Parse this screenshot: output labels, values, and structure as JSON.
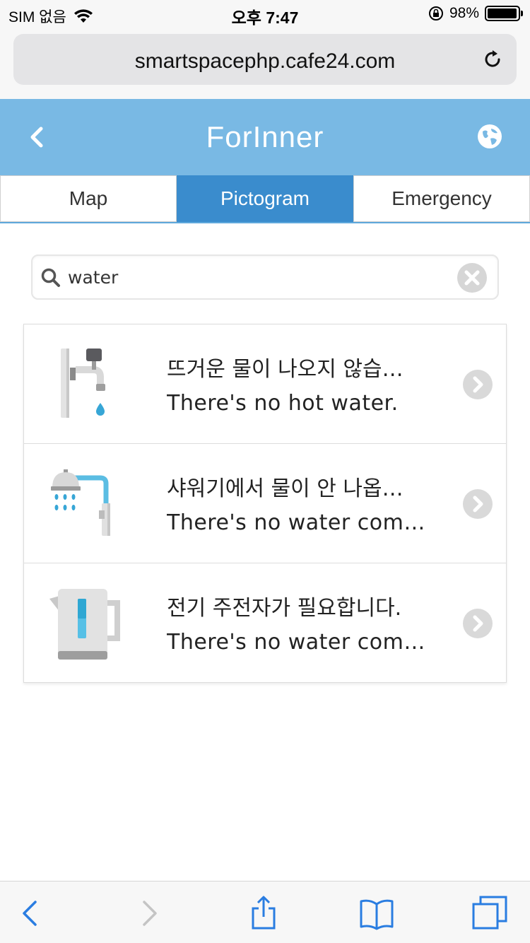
{
  "status": {
    "carrier": "SIM 없음",
    "time": "오후 7:47",
    "battery": "98%",
    "battery_level": 0.98
  },
  "browser": {
    "url": "smartspacephp.cafe24.com"
  },
  "app": {
    "title": "ForInner"
  },
  "tabs": [
    {
      "label": "Map",
      "active": false
    },
    {
      "label": "Pictogram",
      "active": true
    },
    {
      "label": "Emergency",
      "active": false
    }
  ],
  "search": {
    "value": "water"
  },
  "results": [
    {
      "icon": "faucet-icon",
      "ko": "뜨거운 물이 나오지 않습…",
      "en": "There's no hot water."
    },
    {
      "icon": "shower-icon",
      "ko": "샤워기에서 물이 안 나옵…",
      "en": "There's no water com…"
    },
    {
      "icon": "kettle-icon",
      "ko": "전기 주전자가 필요합니다.",
      "en": "There's no water com…"
    }
  ],
  "colors": {
    "header": "#79b9e4",
    "tab_active": "#3a8ccd",
    "ios_blue": "#2a7de1"
  }
}
